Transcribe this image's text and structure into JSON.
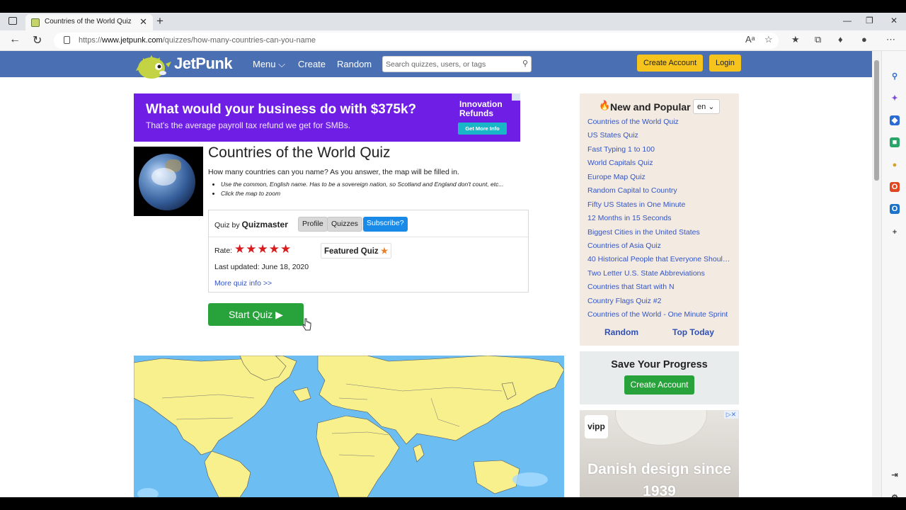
{
  "browser": {
    "tab_title": "Countries of the World Quiz",
    "tab_close": "✕",
    "new_tab": "+",
    "url_prefix": "https://",
    "url_domain": "www.jetpunk.com",
    "url_path": "/quizzes/how-many-countries-can-you-name",
    "window_controls": [
      "—",
      "❐",
      "✕"
    ]
  },
  "site": {
    "logo_text": "JetPunk",
    "nav": [
      "Menu ⌵",
      "Create",
      "Random"
    ],
    "search_placeholder": "Search quizzes, users, or tags",
    "create_account": "Create Account",
    "login": "Login"
  },
  "ad_top": {
    "headline": "What would your business do with $375k?",
    "sub": "That's the average payroll tax refund we get for SMBs.",
    "right_title": "Innovation Refunds",
    "cta": "Get More Info"
  },
  "quiz": {
    "title": "Countries of the World Quiz",
    "description": "How many countries can you name? As you answer, the map will be filled in.",
    "bullets": [
      "Use the common, English name. Has to be a sovereign nation, so Scotland and England don't count, etc...",
      "Click the map to zoom"
    ],
    "quiz_by_label": "Quiz by",
    "author": "Quizmaster",
    "buttons": [
      "Profile",
      "Quizzes",
      "Subscribe?"
    ],
    "rate_label": "Rate:",
    "stars": "★★★★★",
    "featured_label": "Featured Quiz",
    "featured_star": "★",
    "last_updated": "Last updated: June 18, 2020",
    "more_info": "More quiz info >>",
    "start_button": "Start Quiz ▶"
  },
  "sidebar": {
    "title": "New and Popular",
    "language": "en ⌄",
    "links": [
      "Countries of the World Quiz",
      "US States Quiz",
      "Fast Typing 1 to 100",
      "World Capitals Quiz",
      "Europe Map Quiz",
      "Random Capital to Country",
      "Fifty US States in One Minute",
      "12 Months in 15 Seconds",
      "Biggest Cities in the United States",
      "Countries of Asia Quiz",
      "40 Historical People that Everyone Shoul…",
      "Two Letter U.S. State Abbreviations",
      "Countries that Start with N",
      "Country Flags Quiz #2",
      "Countries of the World - One Minute Sprint"
    ],
    "random": "Random",
    "top_today": "Top Today"
  },
  "save_progress": {
    "title": "Save Your Progress",
    "button": "Create Account"
  },
  "ad_side": {
    "brand": "vipp",
    "text": "Danish design since 1939",
    "close": "▷✕"
  },
  "colors": {
    "header_blue": "#4a70b3",
    "button_yellow": "#f7c31d",
    "start_green": "#28a33b",
    "link_blue": "#3454c4",
    "ocean": "#6cbef2",
    "land": "#f7f08c"
  }
}
